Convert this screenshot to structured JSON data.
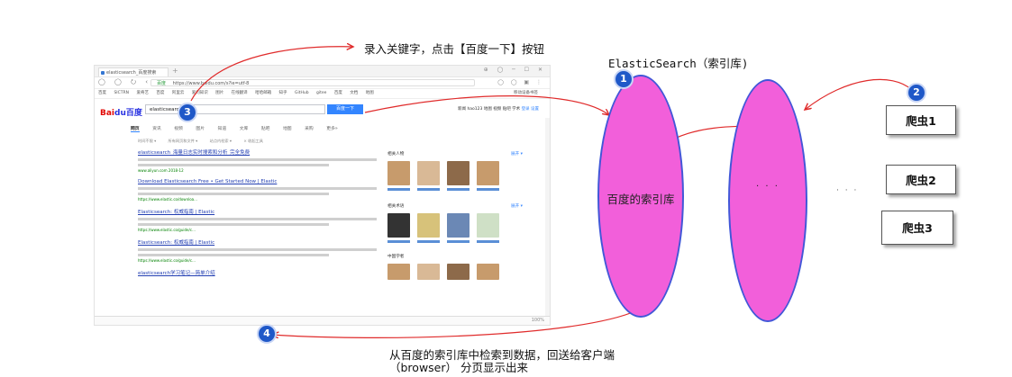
{
  "browser": {
    "tab_title": "elasticsearch_百度搜索",
    "new_tab": "+",
    "window_controls": "⊕ ◯ ─ ☐ ✕",
    "nav_buttons": "◯ ◯ ⭮ ‹",
    "url_secure": "百度",
    "url": "https://www.baidu.com/s?ie=utf-8",
    "right_controls": "◯ ◯ ▣ ⋮",
    "bookmarks": [
      "百度",
      "SICTRN",
      "爱奇艺",
      "百度",
      "阿里云",
      "爱问知识",
      "图片",
      "在线翻译",
      "哈哈邮箱",
      "知乎",
      "GitHub",
      "gitee",
      "百度",
      "文档",
      "地图"
    ],
    "bookmarks_right": "移动设备书签",
    "search_logo_a": "Bai",
    "search_logo_b": "du百度",
    "search_query": "elasticsearch",
    "search_button": "百度一下",
    "top_links": "新闻 hao123 地图 视频 贴吧 学术",
    "top_links_highlight": "登录 设置",
    "nav_tabs": [
      "网页",
      "资讯",
      "视频",
      "图片",
      "知道",
      "文库",
      "贴吧",
      "地图",
      "采购",
      "更多»"
    ],
    "filters": [
      "时间不限 ▾",
      "所有网页和文件 ▾",
      "站点内检索 ▾",
      "× 收起工具"
    ],
    "results": [
      {
        "title": "elasticsearch_海量日志实时搜索和分析_完全免费",
        "url": "www.aliyun.com  2018-12"
      },
      {
        "title": "Download Elasticsearch Free • Get Started Now | Elastic",
        "url": "https://www.elastic.co/downloa..."
      },
      {
        "title": "Elasticsearch: 权威指南 | Elastic",
        "url": "https://www.elastic.co/guide/c..."
      },
      {
        "title": "Elasticsearch: 权威指南 | Elastic",
        "url": "https://www.elastic.co/guide/c..."
      },
      {
        "title": "elasticsearch学习笔记—简单介绍",
        "url": ""
      }
    ],
    "sidebar_head1": "相关人物",
    "sidebar_head2": "相关术语",
    "sidebar_head3": "中国学者",
    "sidebar_more": "展开 ▾",
    "status": "100%"
  },
  "diagram": {
    "note_top": "录入关键字，点击【百度一下】按钮",
    "es_title": "ElasticSearch（索引库)",
    "baidu_index_label": "百度的索引库",
    "inner_dots": "· · ·",
    "outer_dots": "· · ·",
    "crawlers": [
      "爬虫1",
      "爬虫2",
      "爬虫3"
    ],
    "badges": [
      "1",
      "2",
      "3",
      "4"
    ],
    "note_bottom": "从百度的索引库中检索到数据，回送给客户端（browser）  分页显示出来"
  },
  "colors": {
    "ellipse_fill": "#f25fda",
    "ellipse_border": "#4257d8",
    "arrow": "#e02b2b",
    "badge": "#1f58c8"
  }
}
